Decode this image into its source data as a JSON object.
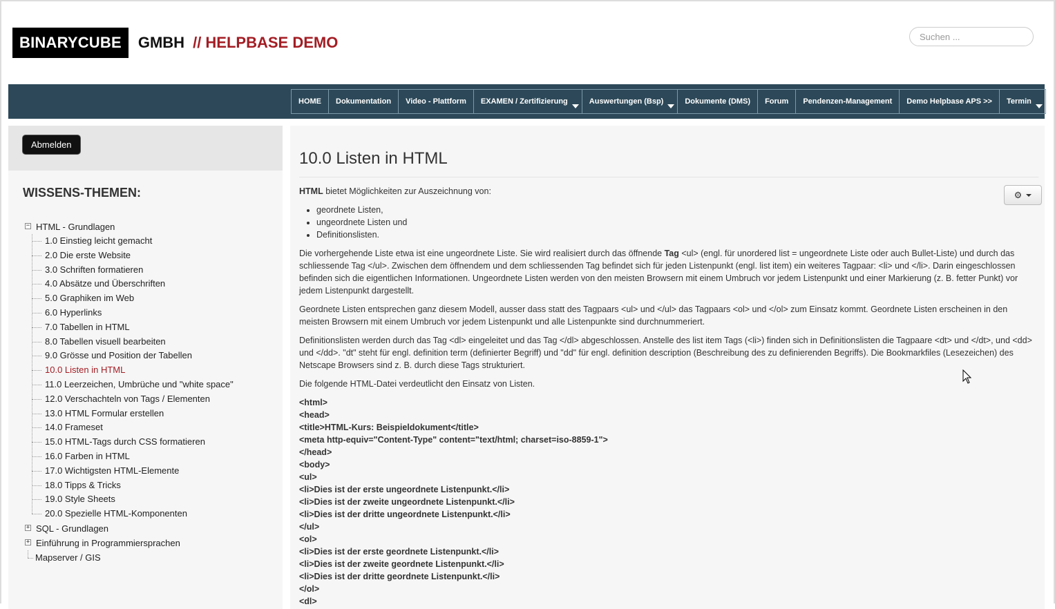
{
  "header": {
    "logo_box": "BINARYCUBE",
    "logo_gmbh": "GMBH",
    "logo_demo": "// HELPBASE DEMO",
    "search_placeholder": "Suchen ..."
  },
  "nav": [
    {
      "label": "HOME",
      "dropdown": false
    },
    {
      "label": "Dokumentation",
      "dropdown": false
    },
    {
      "label": "Video - Plattform",
      "dropdown": false
    },
    {
      "label": "EXAMEN / Zertifizierung",
      "dropdown": true
    },
    {
      "label": "Auswertungen (Bsp)",
      "dropdown": true
    },
    {
      "label": "Dokumente (DMS)",
      "dropdown": false
    },
    {
      "label": "Forum",
      "dropdown": false
    },
    {
      "label": "Pendenzen-Management",
      "dropdown": false
    },
    {
      "label": "Demo Helpbase APS >>",
      "dropdown": false
    },
    {
      "label": "Termin",
      "dropdown": true
    }
  ],
  "sidebar": {
    "logout_label": "Abmelden",
    "title": "WISSENS-THEMEN:",
    "tree_root": "HTML - Grundlagen",
    "tree_children": [
      "1.0 Einstieg leicht gemacht",
      "2.0 Die erste Website",
      "3.0 Schriften formatieren",
      "4.0 Absätze und Überschriften",
      "5.0 Graphiken im Web",
      "6.0 Hyperlinks",
      "7.0 Tabellen in HTML",
      "8.0 Tabellen visuell bearbeiten",
      "9.0 Grösse und Position der Tabellen",
      "10.0 Listen in HTML",
      "11.0 Leerzeichen, Umbrüche und \"white space\"",
      "12.0 Verschachteln von Tags / Elementen",
      "13.0 HTML Formular erstellen",
      "14.0 Frameset",
      "15.0 HTML-Tags durch CSS formatieren",
      "16.0 Farben in HTML",
      "17.0 Wichtigsten HTML-Elemente",
      "18.0 Tipps & Tricks",
      "19.0 Style Sheets",
      "20.0 Spezielle HTML-Komponenten"
    ],
    "active_index": 9,
    "other_roots": [
      {
        "label": "SQL - Grundlagen",
        "expandable": true
      },
      {
        "label": "Einführung in Programmiersprachen",
        "expandable": true
      },
      {
        "label": "Mapserver / GIS",
        "expandable": false
      }
    ]
  },
  "main": {
    "title": "10.0 Listen in HTML",
    "intro_bold": "HTML",
    "intro_rest": " bietet Möglichkeiten zur Auszeichnung von:",
    "bullets": [
      "geordnete Listen,",
      "ungeordnete Listen und",
      "Definitionslisten."
    ],
    "p1_a": "Die vorhergehende Liste etwa ist eine ungeordnete Liste. Sie wird realisiert durch das öffnende ",
    "p1_bold": "Tag",
    "p1_b": " <ul> (engl. für unordered list = ungeordnete Liste oder auch Bullet-Liste) und durch das schliessende Tag </ul>. Zwischen dem öffnendem und dem schliessenden Tag befindet sich für jeden Listenpunkt (engl. list item) ein weiteres Tagpaar: <li> und </li>. Darin eingeschlossen befinden sich die eigentlichen Informationen. Ungeordnete Listen werden von den meisten Browsern mit einem Umbruch vor jedem Listenpunkt und einer Markierung (z. B. fetter Punkt) vor jedem Listenpunkt dargestellt.",
    "p2": "Geordnete Listen entsprechen ganz diesem Modell, ausser dass statt des Tagpaars <ul> und </ul> das Tagpaars <ol> und </ol> zum Einsatz kommt. Geordnete Listen erscheinen in den meisten Browsern mit einem Umbruch vor jedem Listenpunkt und alle Listenpunkte sind durchnummeriert.",
    "p3": "Definitionslisten werden durch das Tag <dl> eingeleitet und das Tag </dl> abgeschlossen. Anstelle des list item Tags (<li>) finden sich in Definitionslisten die Tagpaare <dt> und </dt>, und <dd> und </dd>. \"dt\" steht für engl. definition term (definierter Begriff) und \"dd\" für engl. definition description (Beschreibung des zu definierenden Begriffs). Die Bookmarkfiles (Lesezeichen) des Netscape Browsers sind z. B. durch diese Tags strukturiert.",
    "p4": "Die folgende HTML-Datei verdeutlicht den Einsatz von Listen.",
    "code_lines": [
      "<html>",
      "<head>",
      "<title>HTML-Kurs: Beispieldokument</title>",
      "<meta http-equiv=\"Content-Type\" content=\"text/html; charset=iso-8859-1\">",
      "</head>",
      "<body>",
      "<ul>",
      "<li>Dies ist der erste ungeordnete Listenpunkt.</li>",
      "<li>Dies ist der zweite ungeordnete Listenpunkt.</li>",
      "<li>Dies ist der dritte ungeordnete Listenpunkt.</li>",
      "</ul>",
      "<ol>",
      "<li>Dies ist der erste geordnete Listenpunkt.</li>",
      "<li>Dies ist der zweite geordnete Listenpunkt.</li>",
      "<li>Dies ist der dritte geordnete Listenpunkt.</li>",
      "</ol>",
      "<dl>"
    ]
  },
  "colors": {
    "navbar": "#2d4959",
    "accent_red": "#a31d24",
    "logo_bg": "#000000"
  }
}
